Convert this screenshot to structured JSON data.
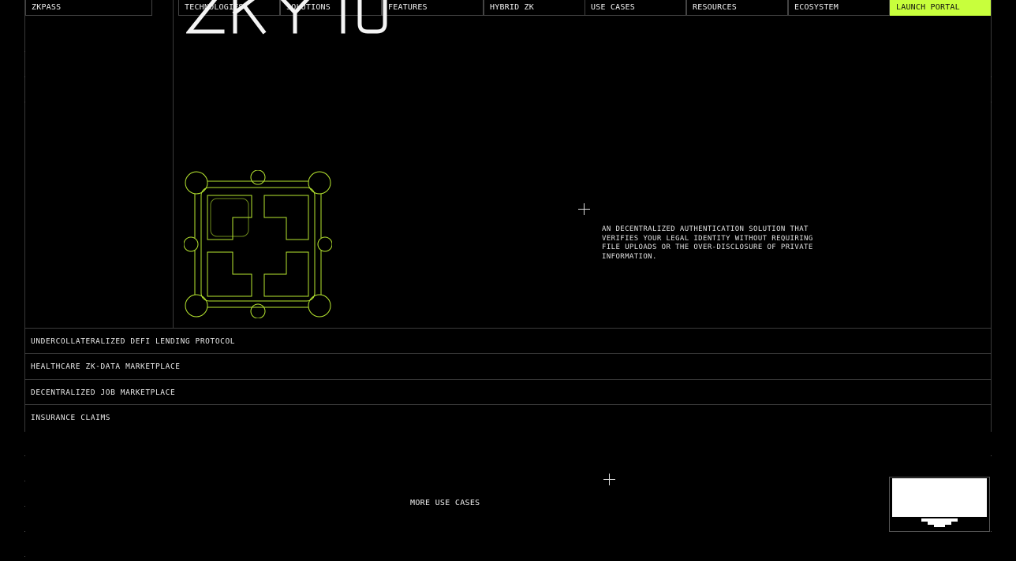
{
  "brand": {
    "logo_text": "ZKPASS"
  },
  "nav": {
    "items": [
      {
        "label": "TECHNOLOGIES"
      },
      {
        "label": "SOLUTIONS"
      },
      {
        "label": "FEATURES"
      },
      {
        "label": "HYBRID ZK"
      },
      {
        "label": "USE CASES"
      },
      {
        "label": "RESOURCES"
      },
      {
        "label": "ECOSYSTEM"
      }
    ],
    "launch_label": "LAUNCH PORTAL"
  },
  "hero": {
    "title_fragment": "ZKTO",
    "description": "AN DECENTRALIZED AUTHENTICATION SOLUTION THAT VERIFIES YOUR LEGAL IDENTITY WITHOUT REQUIRING FILE UPLOADS OR THE OVER-DISCLOSURE OF PRIVATE INFORMATION."
  },
  "use_cases": [
    {
      "label": "UNDERCOLLATERALIZED DEFI LENDING PROTOCOL"
    },
    {
      "label": "HEALTHCARE ZK-DATA MARKETPLACE"
    },
    {
      "label": "DECENTRALIZED JOB MARKETPLACE"
    },
    {
      "label": "INSURANCE CLAIMS"
    }
  ],
  "more_use_cases": "MORE USE CASES",
  "colors": {
    "accent": "#c8ff3c",
    "logo_stroke": "#b8e830",
    "background": "#000000"
  },
  "icons": {
    "plus": "plus-icon",
    "emblem": "zk-emblem-icon",
    "monitor": "monitor-icon"
  }
}
